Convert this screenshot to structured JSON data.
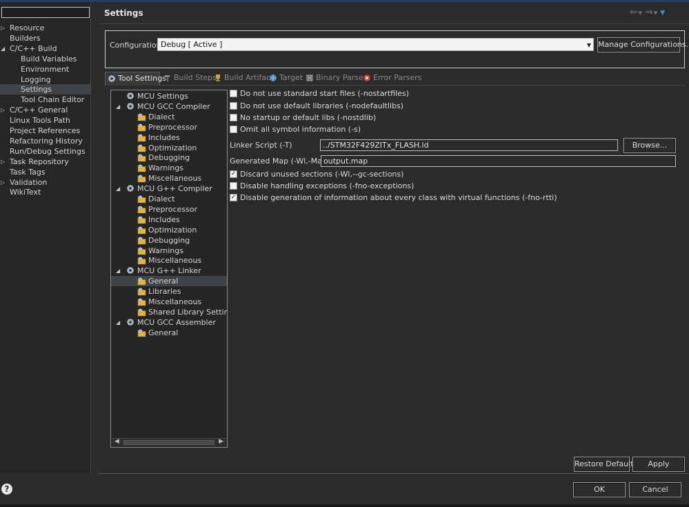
{
  "window": {
    "title": "Settings"
  },
  "filter": {
    "value": "",
    "placeholder": ""
  },
  "nav": {
    "items": [
      {
        "label": "Resource",
        "expandable": true
      },
      {
        "label": "Builders"
      },
      {
        "label": "C/C++ Build",
        "expanded": true
      },
      {
        "label": "Build Variables",
        "child": true
      },
      {
        "label": "Environment",
        "child": true
      },
      {
        "label": "Logging",
        "child": true
      },
      {
        "label": "Settings",
        "child": true,
        "selected": true
      },
      {
        "label": "Tool Chain Editor",
        "child": true
      },
      {
        "label": "C/C++ General",
        "expandable": true
      },
      {
        "label": "Linux Tools Path"
      },
      {
        "label": "Project References"
      },
      {
        "label": "Refactoring History"
      },
      {
        "label": "Run/Debug Settings"
      },
      {
        "label": "Task Repository",
        "expandable": true
      },
      {
        "label": "Task Tags"
      },
      {
        "label": "Validation",
        "expandable": true
      },
      {
        "label": "WikiText"
      }
    ]
  },
  "configuration": {
    "label": "Configuration:",
    "value": "Debug  [ Active ]",
    "manage_label": "Manage Configurations..."
  },
  "tabs": [
    {
      "label": "Tool Settings",
      "icon": "gear-icon",
      "active": true
    },
    {
      "label": "Build Steps",
      "icon": "hammer-icon"
    },
    {
      "label": "Build Artifact",
      "icon": "trophy-icon"
    },
    {
      "label": "Target",
      "icon": "globe-icon"
    },
    {
      "label": "Binary Parsers",
      "icon": "binary-icon"
    },
    {
      "label": "Error Parsers",
      "icon": "error-icon"
    }
  ],
  "tool_tree": [
    {
      "label": "MCU Settings",
      "level": 0,
      "icon": "gear-icon"
    },
    {
      "label": "MCU GCC Compiler",
      "level": 0,
      "icon": "gear-icon",
      "expanded": true
    },
    {
      "label": "Dialect",
      "level": 1,
      "icon": "folder-gear-icon"
    },
    {
      "label": "Preprocessor",
      "level": 1,
      "icon": "folder-gear-icon"
    },
    {
      "label": "Includes",
      "level": 1,
      "icon": "folder-gear-icon"
    },
    {
      "label": "Optimization",
      "level": 1,
      "icon": "folder-gear-icon"
    },
    {
      "label": "Debugging",
      "level": 1,
      "icon": "folder-gear-icon"
    },
    {
      "label": "Warnings",
      "level": 1,
      "icon": "folder-gear-icon"
    },
    {
      "label": "Miscellaneous",
      "level": 1,
      "icon": "folder-gear-icon"
    },
    {
      "label": "MCU G++ Compiler",
      "level": 0,
      "icon": "gear-icon",
      "expanded": true
    },
    {
      "label": "Dialect",
      "level": 1,
      "icon": "folder-gear-icon"
    },
    {
      "label": "Preprocessor",
      "level": 1,
      "icon": "folder-gear-icon"
    },
    {
      "label": "Includes",
      "level": 1,
      "icon": "folder-gear-icon"
    },
    {
      "label": "Optimization",
      "level": 1,
      "icon": "folder-gear-icon"
    },
    {
      "label": "Debugging",
      "level": 1,
      "icon": "folder-gear-icon"
    },
    {
      "label": "Warnings",
      "level": 1,
      "icon": "folder-gear-icon"
    },
    {
      "label": "Miscellaneous",
      "level": 1,
      "icon": "folder-gear-icon"
    },
    {
      "label": "MCU G++ Linker",
      "level": 0,
      "icon": "gear-icon",
      "expanded": true
    },
    {
      "label": "General",
      "level": 1,
      "icon": "folder-gear-icon",
      "selected": true
    },
    {
      "label": "Libraries",
      "level": 1,
      "icon": "folder-gear-icon"
    },
    {
      "label": "Miscellaneous",
      "level": 1,
      "icon": "folder-gear-icon"
    },
    {
      "label": "Shared Library Settings",
      "level": 1,
      "icon": "folder-gear-icon"
    },
    {
      "label": "MCU GCC Assembler",
      "level": 0,
      "icon": "gear-icon",
      "expanded": true
    },
    {
      "label": "General",
      "level": 1,
      "icon": "folder-gear-icon"
    }
  ],
  "options": {
    "checkboxes_top": [
      {
        "label": "Do not use standard start files (-nostartfiles)",
        "checked": false
      },
      {
        "label": "Do not use default libraries (-nodefaultlibs)",
        "checked": false
      },
      {
        "label": "No startup or default libs (-nostdlib)",
        "checked": false
      },
      {
        "label": "Omit all symbol information (-s)",
        "checked": false
      }
    ],
    "linker_script": {
      "label": "Linker Script (-T)",
      "value": "../STM32F429ZITx_FLASH.ld",
      "browse_label": "Browse..."
    },
    "generated_map": {
      "label": "Generated Map (-Wl,-Map=)",
      "value": "output.map"
    },
    "checkboxes_bottom": [
      {
        "label": "Discard unused sections (-Wl,--gc-sections)",
        "checked": true
      },
      {
        "label": "Disable handling exceptions (-fno-exceptions)",
        "checked": false
      },
      {
        "label": "Disable generation of information about every class with virtual functions (-fno-rtti)",
        "checked": true
      }
    ]
  },
  "buttons": {
    "restore_defaults": "Restore Defaults",
    "apply": "Apply",
    "ok": "OK",
    "cancel": "Cancel"
  },
  "colors": {
    "background": "#2b2b2b",
    "selection": "#3f4448",
    "view_menu_accent": "#3f8fe0",
    "folder_icon": "#e8b640"
  }
}
